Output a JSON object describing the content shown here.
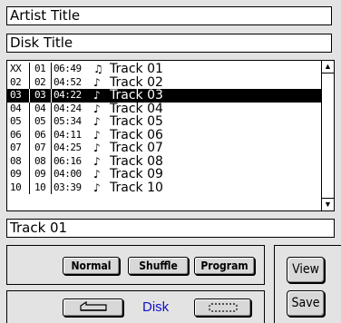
{
  "artist_title": "Artist Title",
  "disk_title": "Disk Title",
  "current_track": "Track 01",
  "scroll": {
    "up_icon": "up-arrow",
    "down_icon": "down-arrow"
  },
  "tracks": [
    {
      "idx": "XX",
      "num": "01",
      "time": "06:49",
      "icon": "eighth-note-inverse-icon",
      "glyph": "♫",
      "name": "Track 01"
    },
    {
      "idx": "02",
      "num": "02",
      "time": "04:52",
      "icon": "note-icon",
      "glyph": "♪",
      "name": "Track 02"
    },
    {
      "idx": "03",
      "num": "03",
      "time": "04:22",
      "icon": "note-icon",
      "glyph": "♪",
      "name": "Track 03",
      "selected": true
    },
    {
      "idx": "04",
      "num": "04",
      "time": "04:24",
      "icon": "note-icon",
      "glyph": "♪",
      "name": "Track 04"
    },
    {
      "idx": "05",
      "num": "05",
      "time": "05:34",
      "icon": "note-icon",
      "glyph": "♪",
      "name": "Track 05"
    },
    {
      "idx": "06",
      "num": "06",
      "time": "04:11",
      "icon": "note-icon",
      "glyph": "♪",
      "name": "Track 06"
    },
    {
      "idx": "07",
      "num": "07",
      "time": "04:25",
      "icon": "note-icon",
      "glyph": "♪",
      "name": "Track 07"
    },
    {
      "idx": "08",
      "num": "08",
      "time": "06:16",
      "icon": "note-icon",
      "glyph": "♪",
      "name": "Track 08"
    },
    {
      "idx": "09",
      "num": "09",
      "time": "04:00",
      "icon": "note-icon",
      "glyph": "♪",
      "name": "Track 09"
    },
    {
      "idx": "10",
      "num": "10",
      "time": "03:39",
      "icon": "note-icon",
      "glyph": "♪",
      "name": "Track 10"
    }
  ],
  "modes": {
    "normal": "Normal",
    "shuffle": "Shuffle",
    "program": "Program"
  },
  "disk_controls": {
    "back_icon": "back-arrow-icon",
    "label": "Disk",
    "eject_icon": "disk-icon"
  },
  "side": {
    "view": "View",
    "save": "Save"
  },
  "colors": {
    "disk_label": "#1010c8",
    "background": "#e3e3e3"
  }
}
